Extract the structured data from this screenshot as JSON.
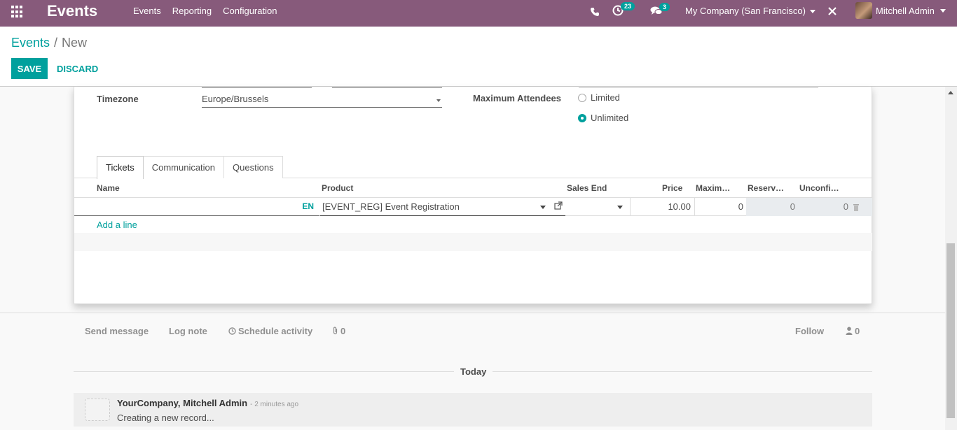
{
  "navbar": {
    "app_title": "Events",
    "menu": [
      "Events",
      "Reporting",
      "Configuration"
    ],
    "activity_count": "23",
    "message_count": "3",
    "company": "My Company (San Francisco)",
    "user": "Mitchell Admin"
  },
  "breadcrumb": {
    "parent": "Events",
    "separator": "/",
    "current": "New"
  },
  "actions": {
    "save": "SAVE",
    "discard": "DISCARD"
  },
  "form": {
    "timezone_label": "Timezone",
    "timezone_value": "Europe/Brussels",
    "max_attendees_label": "Maximum Attendees",
    "options": {
      "limited": "Limited",
      "unlimited": "Unlimited",
      "selected": "Unlimited"
    }
  },
  "tabs": [
    "Tickets",
    "Communication",
    "Questions"
  ],
  "tickets": {
    "columns": [
      "Name",
      "Product",
      "Sales End",
      "Price",
      "Maxim…",
      "Reserv…",
      "Unconfi…"
    ],
    "rows": [
      {
        "name": "",
        "lang": "EN",
        "product": "[EVENT_REG] Event Registration",
        "sales_end": "",
        "price": "10.00",
        "maximum": "0",
        "reserved": "0",
        "unconfirmed": "0"
      }
    ],
    "add_line": "Add a line"
  },
  "chatter": {
    "send_message": "Send message",
    "log_note": "Log note",
    "schedule_activity": "Schedule activity",
    "attachments": "0",
    "follow": "Follow",
    "followers": "0",
    "date_separator": "Today",
    "messages": [
      {
        "author": "YourCompany, Mitchell Admin",
        "date": "- 2 minutes ago",
        "body": "Creating a new record..."
      }
    ]
  },
  "colors": {
    "navbar": "#875a7b",
    "accent": "#00a09d"
  }
}
